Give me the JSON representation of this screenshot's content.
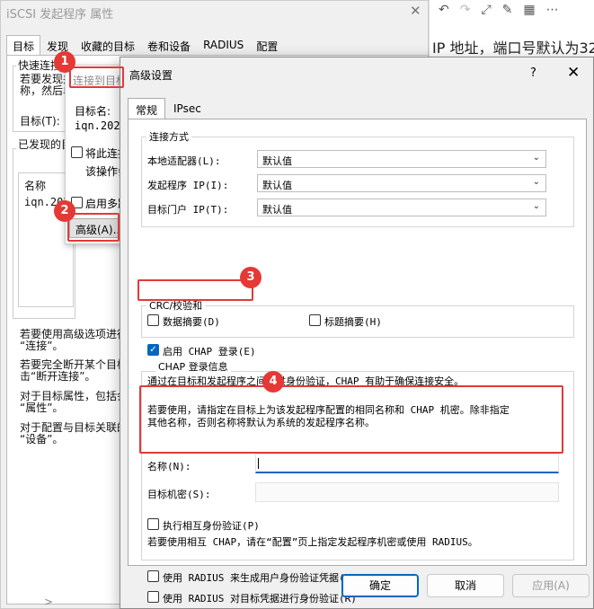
{
  "background_doc": {
    "toolbar_icons": [
      "undo-icon",
      "redo-icon",
      "expand-icon",
      "pen-icon",
      "grid-icon",
      "more-icon"
    ],
    "text": "IP 地址，端口号默认为32"
  },
  "back_window": {
    "title": "iSCSI 发起程序 属性",
    "tabs": [
      "目标",
      "发现",
      "收藏的目标",
      "卷和设备",
      "RADIUS",
      "配置"
    ],
    "quick_connect_title": "快速连接",
    "quick_connect_text": "若要发现并\n称，然后单",
    "target_label": "目标(T):",
    "discovered_title": "已发现的目",
    "list_header": "名称",
    "list_item": "iqn.2025",
    "help1": "若要使用高级选项进行\n“连接”。",
    "help2": "若要完全断开某个目标\n击“断开连接”。",
    "help3": "对于目标属性，包括会\n“属性”。",
    "help4": "对于配置与目标关联的\n“设备”。",
    "scroll_arrow": ">"
  },
  "connect_dialog": {
    "title": "连接到目标",
    "target_name_label": "目标名:",
    "target_name_value": "iqn.2025-",
    "favorite_label": "将此连接",
    "favorite_note": "该操作会",
    "multipath_label": "启用多路",
    "advanced_button": "高级(A)..."
  },
  "advanced": {
    "title": "高级设置",
    "help_label": "?",
    "tabs": [
      "常规",
      "IPsec"
    ],
    "connection_group": "连接方式",
    "local_adapter_label": "本地适配器(L):",
    "local_adapter_value": "默认值",
    "initiator_ip_label": "发起程序 IP(I):",
    "initiator_ip_value": "默认值",
    "target_portal_label": "目标门户 IP(T):",
    "target_portal_value": "默认值",
    "crc_group": "CRC/校验和",
    "data_digest_label": "数据摘要(D)",
    "header_digest_label": "标题摘要(H)",
    "chap_enable_label": "启用 CHAP 登录(E)",
    "chap_info_title": "CHAP 登录信息",
    "chap_desc1": "通过在目标和发起程序之间提供身份验证，CHAP 有助于确保连接安全。",
    "chap_desc2": "若要使用，请指定在目标上为该发起程序配置的相同名称和 CHAP 机密。除非指定\n其他名称，否则名称将默认为系统的发起程序名称。",
    "name_label": "名称(N):",
    "name_value": "",
    "secret_label": "目标机密(S):",
    "secret_value": "",
    "mutual_label": "执行相互身份验证(P)",
    "mutual_desc": "若要使用相互 CHAP，请在“配置”页上指定发起程序机密或使用 RADIUS。",
    "radius_user_label": "使用 RADIUS 来生成用户身份验证凭据(U)",
    "radius_target_label": "使用 RADIUS 对目标凭据进行身份验证(R)",
    "ok_button": "确定",
    "cancel_button": "取消",
    "apply_button": "应用(A)"
  },
  "annotations": [
    "1",
    "2",
    "3",
    "4"
  ],
  "colors": {
    "accent": "#0067c0",
    "annotation_red": "#e53935"
  }
}
